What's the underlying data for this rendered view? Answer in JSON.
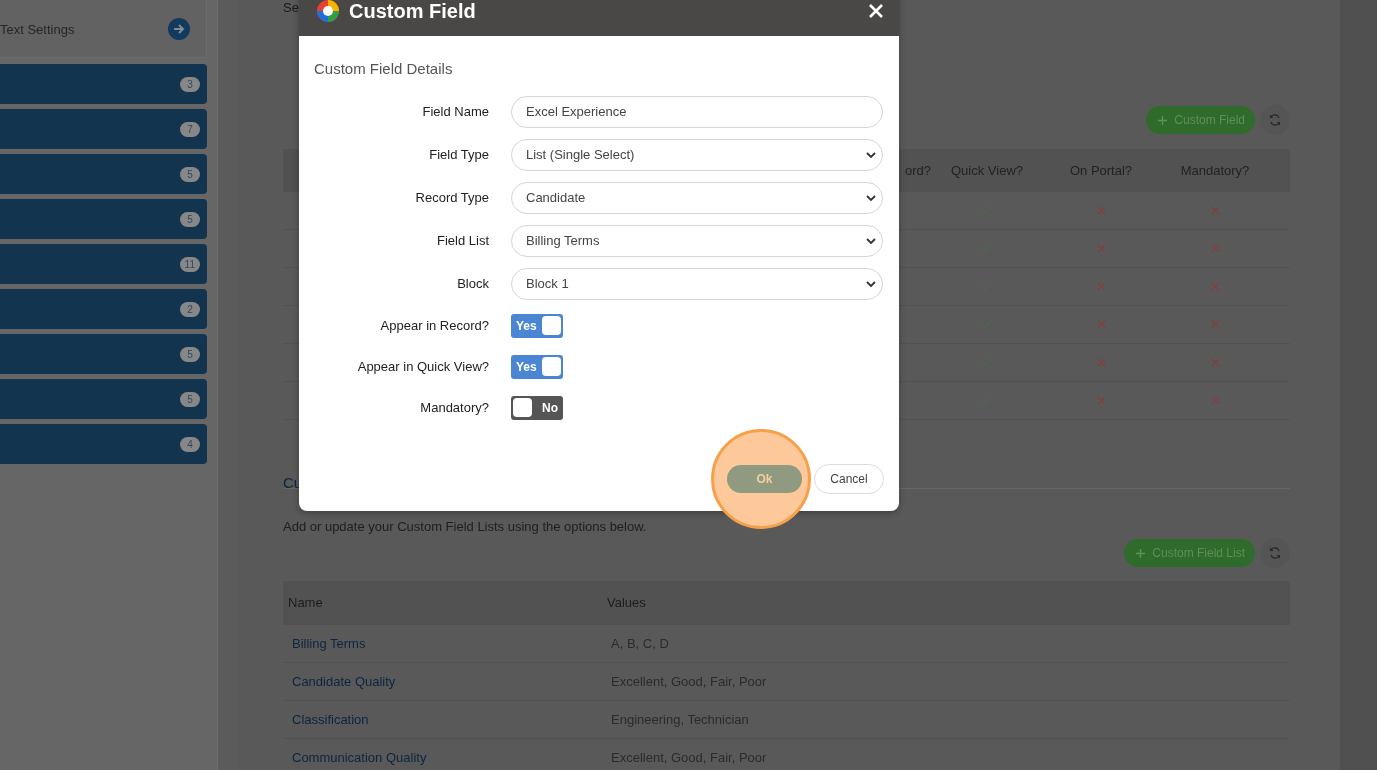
{
  "sidebar": {
    "card": {
      "label": "Text Settings"
    },
    "items": [
      {
        "count": "3"
      },
      {
        "count": "7"
      },
      {
        "count": "5"
      },
      {
        "count": "5"
      },
      {
        "count": "11"
      },
      {
        "count": "2"
      },
      {
        "count": "5"
      },
      {
        "count": "5"
      },
      {
        "count": "4"
      }
    ]
  },
  "main": {
    "heading_fragment": "Se",
    "custom_fields": {
      "add_button": "Custom Field",
      "columns": [
        "ord?",
        "Quick View?",
        "On Portal?",
        "Mandatory?"
      ],
      "rows": [
        {
          "quick_view": true,
          "on_portal": false,
          "mandatory": false
        },
        {
          "quick_view": true,
          "on_portal": false,
          "mandatory": false
        },
        {
          "quick_view": true,
          "on_portal": false,
          "mandatory": false
        },
        {
          "quick_view": true,
          "on_portal": false,
          "mandatory": false
        },
        {
          "quick_view": true,
          "on_portal": false,
          "mandatory": false
        },
        {
          "quick_view": true,
          "on_portal": false,
          "mandatory": false
        }
      ]
    },
    "lists_section": {
      "heading_fragment": "Cu",
      "description": "Add or update your Custom Field Lists using the options below.",
      "add_button": "Custom Field List",
      "columns": [
        "Name",
        "Values"
      ],
      "rows": [
        {
          "name": "Billing Terms",
          "values": "A, B, C, D"
        },
        {
          "name": "Candidate Quality",
          "values": "Excellent, Good, Fair, Poor"
        },
        {
          "name": "Classification",
          "values": "Engineering, Technician"
        },
        {
          "name": "Communication Quality",
          "values": "Excellent, Good, Fair, Poor"
        }
      ]
    }
  },
  "dialog": {
    "title": "Custom Field",
    "section_title": "Custom Field Details",
    "fields": [
      {
        "label": "Field Name",
        "kind": "text",
        "value": "Excel Experience"
      },
      {
        "label": "Field Type",
        "kind": "select",
        "value": "List (Single Select)"
      },
      {
        "label": "Record Type",
        "kind": "select",
        "value": "Candidate"
      },
      {
        "label": "Field List",
        "kind": "select",
        "value": "Billing Terms"
      },
      {
        "label": "Block",
        "kind": "select",
        "value": "Block 1"
      },
      {
        "label": "Appear in Record?",
        "kind": "toggle",
        "on": true,
        "text": "Yes"
      },
      {
        "label": "Appear in Quick View?",
        "kind": "toggle",
        "on": true,
        "text": "Yes"
      },
      {
        "label": "Mandatory?",
        "kind": "toggle",
        "on": false,
        "text": "No"
      }
    ],
    "buttons": [
      {
        "label": "Ok",
        "kind": "primary",
        "highlighted": true
      },
      {
        "label": "Cancel",
        "kind": "secondary",
        "highlighted": false
      }
    ]
  }
}
